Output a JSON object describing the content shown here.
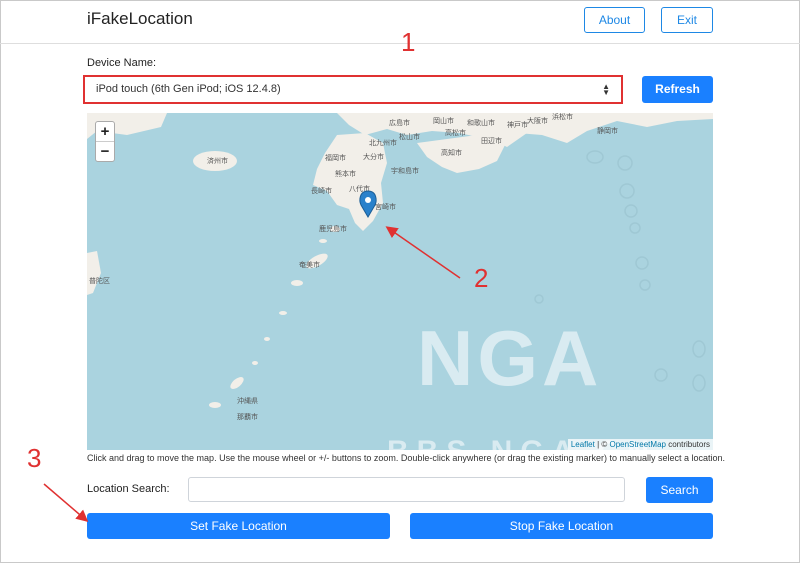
{
  "header": {
    "title": "iFakeLocation",
    "about_label": "About",
    "exit_label": "Exit"
  },
  "device": {
    "label": "Device Name:",
    "selected": "iPod touch (6th Gen iPod; iOS 12.4.8)",
    "refresh_label": "Refresh"
  },
  "map": {
    "zoom_in": "+",
    "zoom_out": "−",
    "attribution_leaflet": "Leaflet",
    "attribution_sep": " | © ",
    "attribution_osm": "OpenStreetMap",
    "attribution_suffix": " contributors",
    "place_labels": [
      "広島市",
      "岡山市",
      "神戸市",
      "大阪市",
      "浜松市",
      "北九州市",
      "松山市",
      "高松市",
      "和歌山市",
      "静岡市",
      "福岡市",
      "大分市",
      "高知市",
      "田辺市",
      "済州市",
      "熊本市",
      "宇和島市",
      "長崎市",
      "宮崎市",
      "八代市",
      "鹿児島市",
      "奄美市",
      "沖縄県",
      "那覇市",
      "普陀区"
    ],
    "watermark_1": "NGA",
    "watermark_2": "BBS.NGA.CN"
  },
  "help_text": "Click and drag to move the map. Use the mouse wheel or +/- buttons to zoom. Double-click anywhere (or drag the existing marker) to manually select a location.",
  "search": {
    "label": "Location Search:",
    "value": "",
    "button_label": "Search"
  },
  "actions": {
    "set_label": "Set Fake Location",
    "stop_label": "Stop Fake Location"
  },
  "annotations": [
    "1",
    "2",
    "3"
  ],
  "colors": {
    "primary": "#1a80ff",
    "annotation": "#e03131",
    "water": "#aad3df",
    "land": "#f2efe9"
  }
}
